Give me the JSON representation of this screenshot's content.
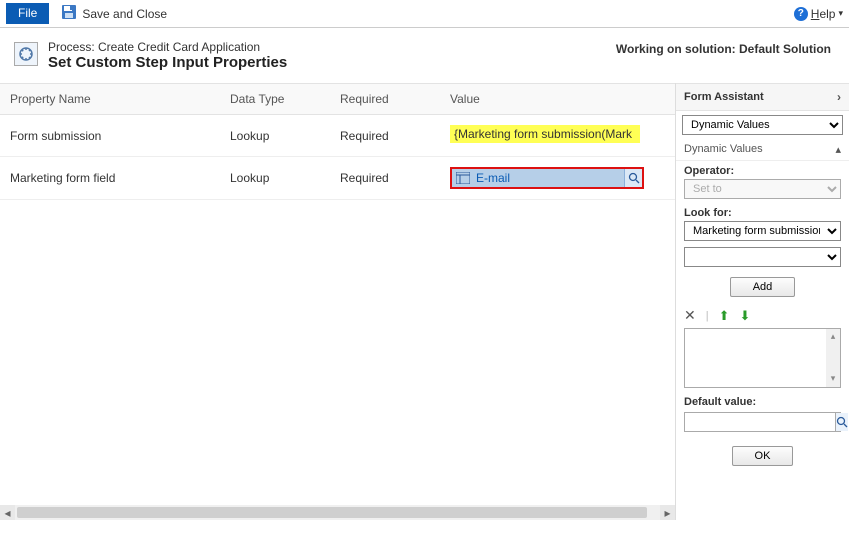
{
  "toolbar": {
    "file_label": "File",
    "save_close_label": "Save and Close",
    "help_label": "Help"
  },
  "header": {
    "process_prefix": "Process: ",
    "process_name": "Create Credit Card Application",
    "title": "Set Custom Step Input Properties",
    "solution_prefix": "Working on solution: ",
    "solution_name": "Default Solution"
  },
  "grid": {
    "columns": {
      "c0": "Property Name",
      "c1": "Data Type",
      "c2": "Required",
      "c3": "Value"
    },
    "rows": [
      {
        "name": "Form submission",
        "dtype": "Lookup",
        "req": "Required",
        "value_display": "{Marketing form submission(Mark",
        "value_kind": "token"
      },
      {
        "name": "Marketing form field",
        "dtype": "Lookup",
        "req": "Required",
        "value_display": "E-mail",
        "value_kind": "lookup"
      }
    ]
  },
  "assistant": {
    "title": "Form Assistant",
    "mode_select": "Dynamic Values",
    "section_label": "Dynamic Values",
    "operator_label": "Operator:",
    "operator_value": "Set to",
    "lookfor_label": "Look for:",
    "lookfor_value": "Marketing form submission",
    "secondary_value": "",
    "add_label": "Add",
    "default_label": "Default value:",
    "default_value": "",
    "ok_label": "OK"
  }
}
